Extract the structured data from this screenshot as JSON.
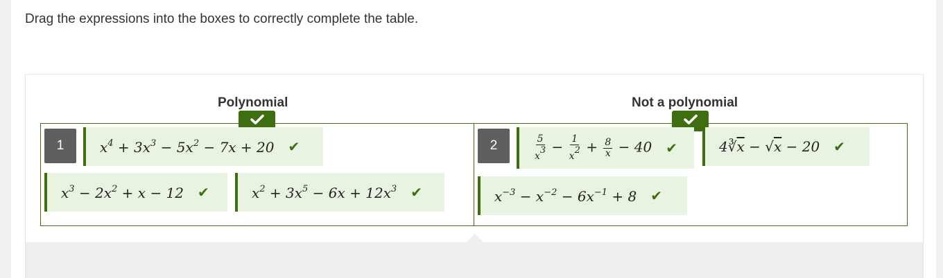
{
  "instructions": "Drag the expressions into the boxes to correctly complete the table.",
  "columns": [
    {
      "header": "Polynomial",
      "number": "1"
    },
    {
      "header": "Not a polynomial",
      "number": "2"
    }
  ],
  "tiles": {
    "poly_1": "x⁴ + 3x³ − 5x² − 7x + 20",
    "poly_2": "x³ − 2x² + x − 12",
    "poly_3": "x² + 3x⁵ − 6x + 12x³",
    "notpoly_1": "5/x³ − 1/x² + 8/x − 40",
    "notpoly_2": "4∛x − √x − 20",
    "notpoly_3": "x⁻³ − x⁻² − 6x⁻¹ + 8"
  },
  "colors": {
    "correct_green": "#3f6e10",
    "tile_bg": "#e9f3e2",
    "badge_gray": "#5f5f5f"
  },
  "icons": {
    "correct": "check-icon"
  }
}
